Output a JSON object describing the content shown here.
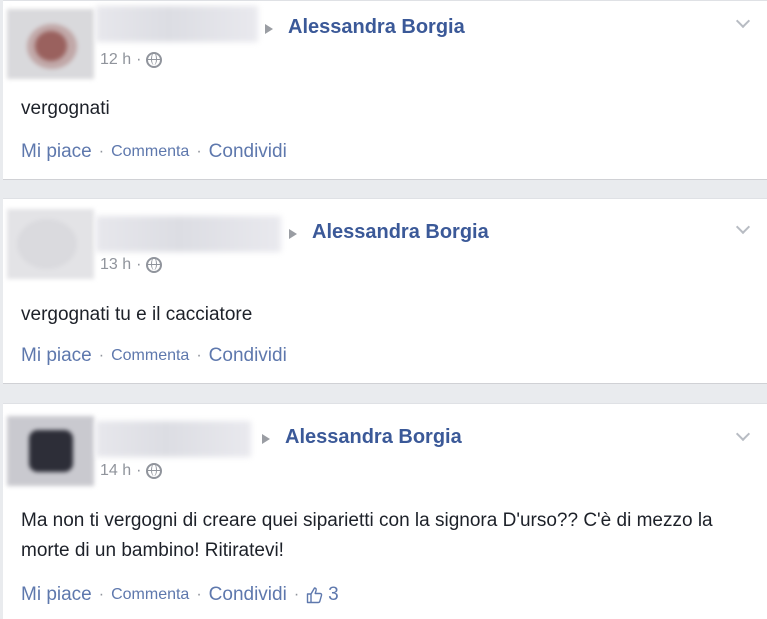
{
  "posts": [
    {
      "target": "Alessandra Borgia",
      "time": "12 h",
      "text": "vergognati",
      "actions": {
        "like": "Mi piace",
        "comment": "Commenta",
        "share": "Condividi"
      }
    },
    {
      "target": "Alessandra Borgia",
      "time": "13 h",
      "text": "vergognati tu e il cacciatore",
      "actions": {
        "like": "Mi piace",
        "comment": "Commenta",
        "share": "Condividi"
      }
    },
    {
      "target": "Alessandra Borgia",
      "time": "14 h",
      "text": "Ma non ti vergogni di creare quei siparietti con la signora D'urso?? C'è di mezzo la morte di un bambino! Ritiratevi!",
      "actions": {
        "like": "Mi piace",
        "comment": "Commenta",
        "share": "Condividi"
      },
      "like_count": "3"
    }
  ],
  "separator": "·",
  "icons": {
    "globe": "globe-icon",
    "chevron": "chevron-down-icon",
    "arrow": "arrow-right-icon",
    "thumb": "thumbs-up-icon"
  },
  "colors": {
    "link": "#3b5998",
    "action": "#5e78ad",
    "meta": "#90949c"
  }
}
